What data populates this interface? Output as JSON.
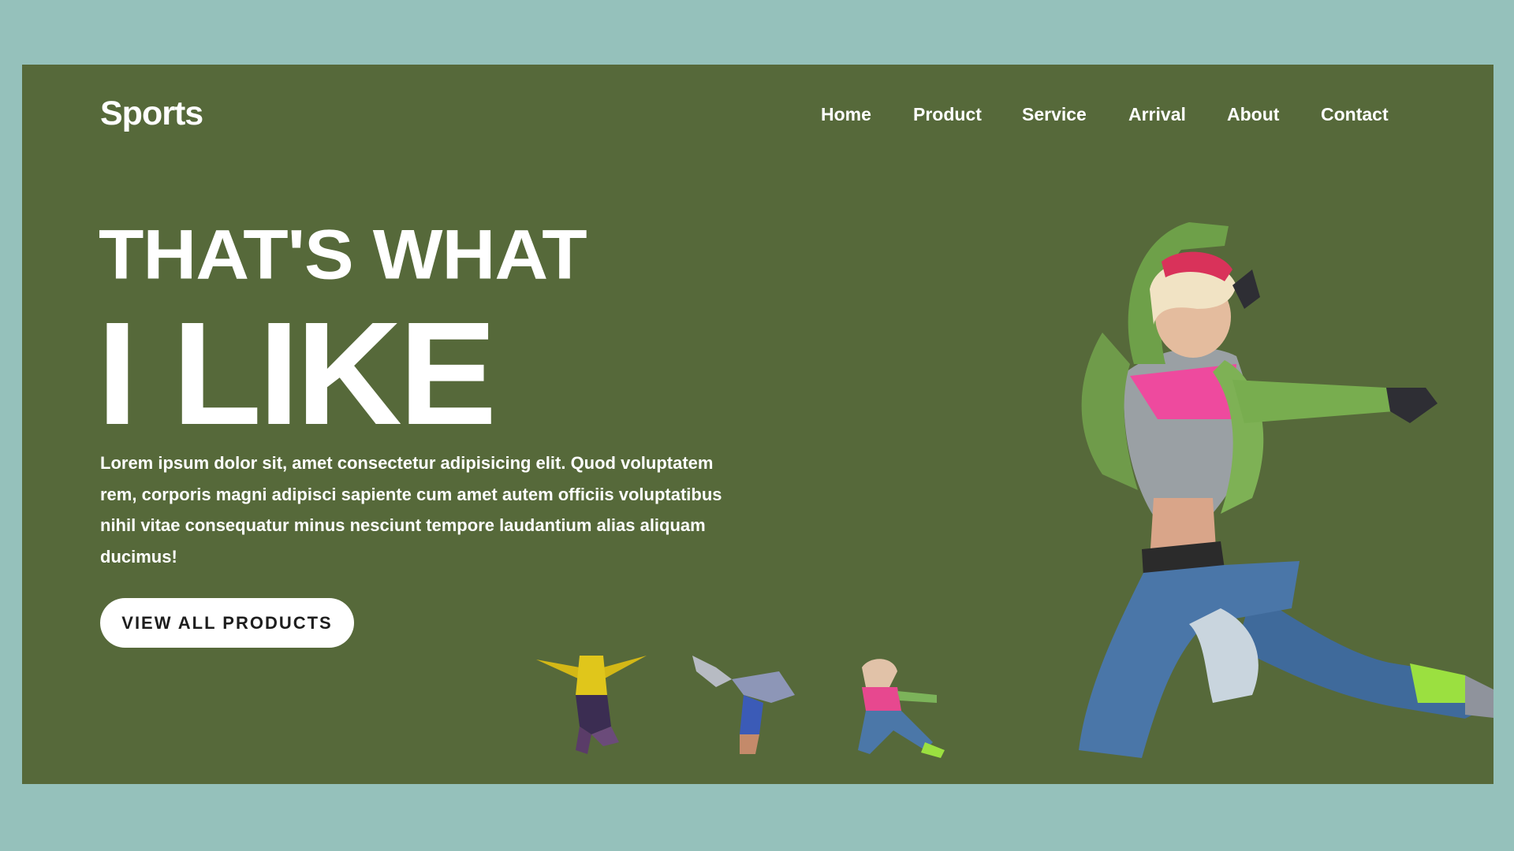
{
  "brand": {
    "logo": "Sports"
  },
  "nav": {
    "items": [
      {
        "label": "Home"
      },
      {
        "label": "Product"
      },
      {
        "label": "Service"
      },
      {
        "label": "Arrival"
      },
      {
        "label": "About"
      },
      {
        "label": "Contact"
      }
    ]
  },
  "hero": {
    "line1": "THAT'S WHAT",
    "line2": "I LIKE",
    "description": "Lorem ipsum dolor sit, amet consectetur adipisicing elit. Quod voluptatem rem, corporis magni adipisci sapiente cum amet autem officiis voluptatibus nihil vitae consequatur minus nesciunt tempore laudantium alias aliquam ducimus!",
    "cta_label": "VIEW ALL PRODUCTS"
  },
  "colors": {
    "page_background": "#95c1bb",
    "card_background": "#56693a",
    "text": "#ffffff",
    "button_background": "#ffffff",
    "button_text": "#1d1d1d"
  },
  "images": {
    "hero": "jumping-dancer-photo",
    "thumbnails": [
      "yellow-hoodie-dancer-thumbnail",
      "breakdancer-thumbnail",
      "jumping-dancer-thumbnail"
    ]
  }
}
